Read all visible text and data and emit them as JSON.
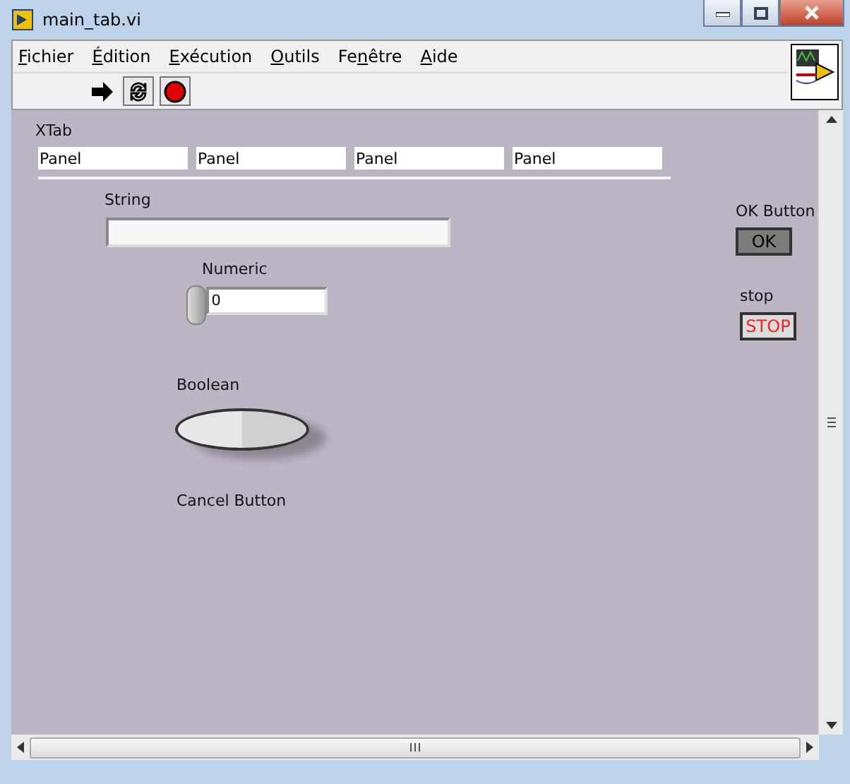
{
  "window": {
    "title": "main_tab.vi"
  },
  "menu": [
    {
      "key": "F",
      "after": "ichier"
    },
    {
      "key": "É",
      "after": "dition"
    },
    {
      "key": "E",
      "after": "xécution"
    },
    {
      "key": "O",
      "after": "utils"
    },
    {
      "before": "Fe",
      "key": "n",
      "after": "être"
    },
    {
      "key": "A",
      "after": "ide"
    }
  ],
  "toolbar": [
    {
      "kind": "run"
    },
    {
      "kind": "run-continuously"
    },
    {
      "kind": "abort"
    }
  ],
  "panel": {
    "xtab": {
      "label": "XTab",
      "tabs": [
        "Panel",
        "Panel",
        "Panel",
        "Panel"
      ]
    },
    "string": {
      "label": "String"
    },
    "numeric": {
      "label": "Numeric",
      "value": "0"
    },
    "boolean": {
      "label": "Boolean",
      "on": false
    },
    "cancel_button": {
      "label": "Cancel Button"
    },
    "ok_button": {
      "label": "OK Button",
      "text": "OK"
    },
    "stop": {
      "label": "stop",
      "text": "STOP"
    }
  }
}
